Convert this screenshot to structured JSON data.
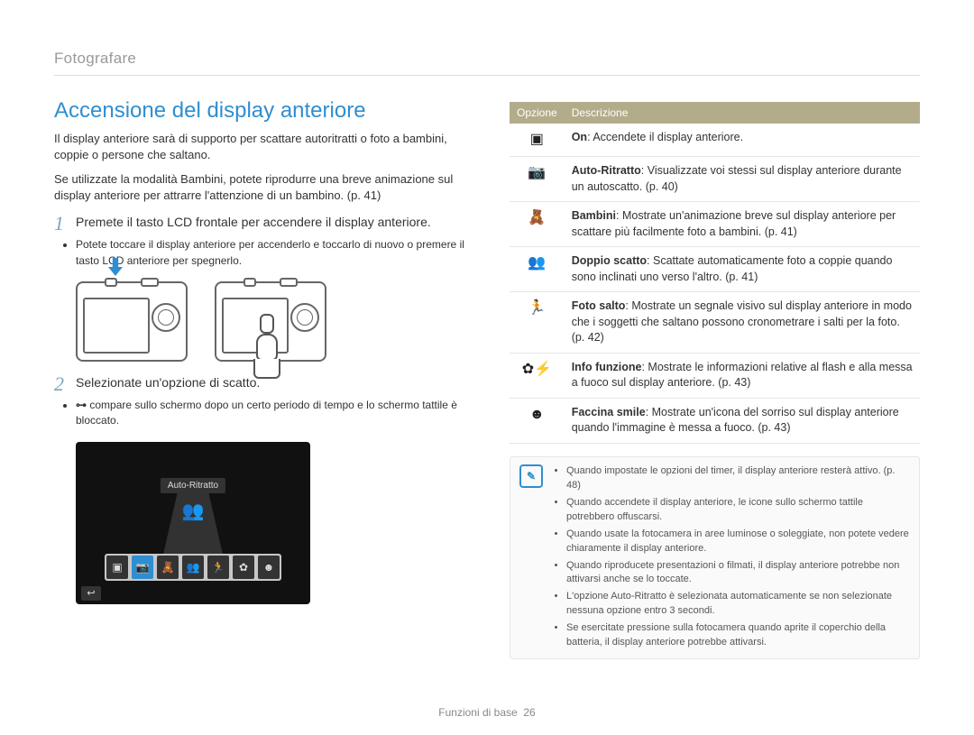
{
  "breadcrumb": "Fotografare",
  "title": "Accensione del display anteriore",
  "intro1": "Il display anteriore sarà di supporto per scattare autoritratti o foto a bambini, coppie o persone che saltano.",
  "intro2": "Se utilizzate la modalità Bambini, potete riprodurre una breve animazione sul display anteriore per attrarre l'attenzione di un bambino. (p. 41)",
  "step1_num": "1",
  "step1_text": "Premete il tasto LCD frontale per accendere il display anteriore.",
  "step1_bullet": "Potete toccare il display anteriore per accenderlo e toccarlo di nuovo o premere il tasto LCD anteriore per spegnerlo.",
  "step2_num": "2",
  "step2_text": "Selezionate un'opzione di scatto.",
  "step2_bullet_pre": "",
  "step2_bullet": "compare sullo schermo dopo un certo periodo di tempo e lo schermo tattile è bloccato.",
  "key_glyph": "⊶",
  "ui_label": "Auto-Ritratto",
  "ui_back": "↩",
  "table_head_opt": "Opzione",
  "table_head_desc": "Descrizione",
  "rows": [
    {
      "icon": "▣",
      "bold": "On",
      "text": ": Accendete il display anteriore."
    },
    {
      "icon": "📷",
      "bold": "Auto-Ritratto",
      "text": ": Visualizzate voi stessi sul display anteriore durante un autoscatto. (p. 40)"
    },
    {
      "icon": "🧸",
      "bold": "Bambini",
      "text": ": Mostrate un'animazione breve sul display anteriore per scattare più facilmente foto a bambini. (p. 41)"
    },
    {
      "icon": "👥",
      "bold": "Doppio scatto",
      "text": ": Scattate automaticamente foto a coppie quando sono inclinati uno verso l'altro. (p. 41)"
    },
    {
      "icon": "🏃",
      "bold": "Foto salto",
      "text": ": Mostrate un segnale visivo sul display anteriore in modo che i soggetti che saltano possono cronometrare i salti per la foto. (p. 42)"
    },
    {
      "icon": "✿⚡",
      "bold": "Info funzione",
      "text": ": Mostrate le informazioni relative al flash e alla messa a fuoco sul display anteriore. (p. 43)"
    },
    {
      "icon": "☻",
      "bold": "Faccina smile",
      "text": ": Mostrate un'icona del sorriso sul display anteriore quando l'immagine è messa a fuoco. (p. 43)"
    }
  ],
  "notes": [
    "Quando impostate le opzioni del timer, il display anteriore resterà attivo. (p. 48)",
    "Quando accendete il display anteriore, le icone sullo schermo tattile potrebbero offuscarsi.",
    "Quando usate la fotocamera in aree luminose o soleggiate, non potete vedere chiaramente il display anteriore.",
    "Quando riproducete presentazioni o filmati, il display anteriore potrebbe non attivarsi anche se lo toccate.",
    "L'opzione Auto-Ritratto è selezionata automaticamente se non selezionate nessuna opzione entro 3 secondi.",
    "Se esercitate pressione sulla fotocamera quando aprite il coperchio della batteria, il display anteriore potrebbe attivarsi."
  ],
  "note_bold_label": "Auto-Ritratto",
  "footer_label": "Funzioni di base",
  "footer_page": "26",
  "strip_icons": [
    "▣",
    "📷",
    "🧸",
    "👥",
    "🏃",
    "✿",
    "☻"
  ]
}
